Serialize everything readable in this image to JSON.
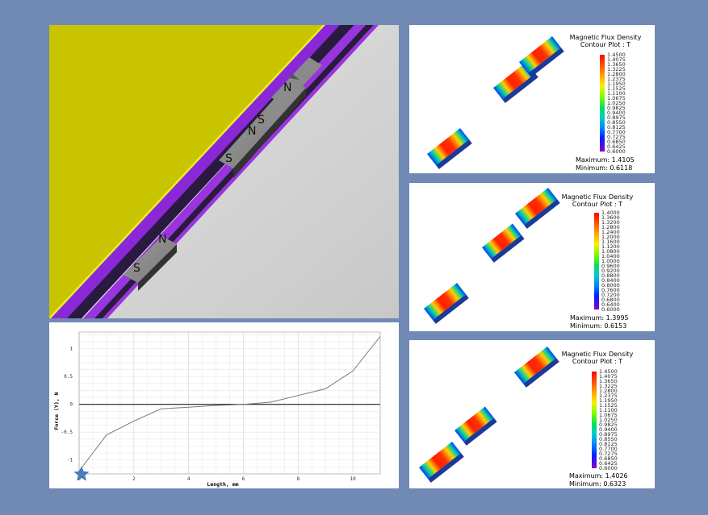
{
  "scene": {
    "magnet_labels": [
      "S",
      "N",
      "S",
      "N",
      "S",
      "N"
    ]
  },
  "force_chart": {
    "xlabel": "Length, mm",
    "ylabel": "Force (Y), N",
    "x_ticks": [
      "0",
      "2",
      "4",
      "6",
      "8",
      "10"
    ],
    "y_ticks": [
      "1",
      "0.5",
      "0",
      "-0.5",
      "-1"
    ],
    "marker": "star"
  },
  "chart_data": {
    "type": "line",
    "xlabel": "Length, mm",
    "ylabel": "Force (Y), N",
    "xlim": [
      0,
      11
    ],
    "ylim": [
      -1.25,
      1.3
    ],
    "x": [
      0,
      1,
      2,
      3,
      4,
      5,
      6,
      7,
      8,
      9,
      10,
      11
    ],
    "series": [
      {
        "values": [
          -1.2,
          -0.55,
          -0.3,
          -0.08,
          -0.05,
          -0.02,
          0.0,
          0.04,
          0.16,
          0.28,
          0.6,
          1.22
        ]
      }
    ],
    "grid": true
  },
  "contours": [
    {
      "title_line1": "Magnetic Flux Density",
      "title_line2": "Contour Plot : T",
      "scale": [
        "1.4500",
        "1.4075",
        "1.3650",
        "1.3225",
        "1.2800",
        "1.2375",
        "1.1950",
        "1.1525",
        "1.1100",
        "1.0675",
        "1.0250",
        "0.9825",
        "0.9400",
        "0.8975",
        "0.8550",
        "0.8125",
        "0.7700",
        "0.7275",
        "0.6850",
        "0.6425",
        "0.6000"
      ],
      "maximum": "Maximum: 1.4105",
      "minimum": "Minimum: 0.6118"
    },
    {
      "title_line1": "Magnetic Flux Density",
      "title_line2": "Contour Plot : T",
      "scale": [
        "1.4000",
        "1.3600",
        "1.3200",
        "1.2800",
        "1.2400",
        "1.2000",
        "1.1600",
        "1.1200",
        "1.0800",
        "1.0400",
        "1.0000",
        "0.9600",
        "0.9200",
        "0.8800",
        "0.8400",
        "0.8000",
        "0.7600",
        "0.7200",
        "0.6800",
        "0.6400",
        "0.6000"
      ],
      "maximum": "Maximum: 1.3995",
      "minimum": "Minimum: 0.6153"
    },
    {
      "title_line1": "Magnetic Flux Density",
      "title_line2": "Contour Plot : T",
      "scale": [
        "1.4500",
        "1.4075",
        "1.3650",
        "1.3225",
        "1.2800",
        "1.2375",
        "1.1950",
        "1.1525",
        "1.1100",
        "1.0675",
        "1.0250",
        "0.9825",
        "0.9400",
        "0.8975",
        "0.8550",
        "0.8125",
        "0.7700",
        "0.7275",
        "0.6850",
        "0.6425",
        "0.6000"
      ],
      "maximum": "Maximum: 1.4026",
      "minimum": "Minimum: 0.6323"
    }
  ]
}
